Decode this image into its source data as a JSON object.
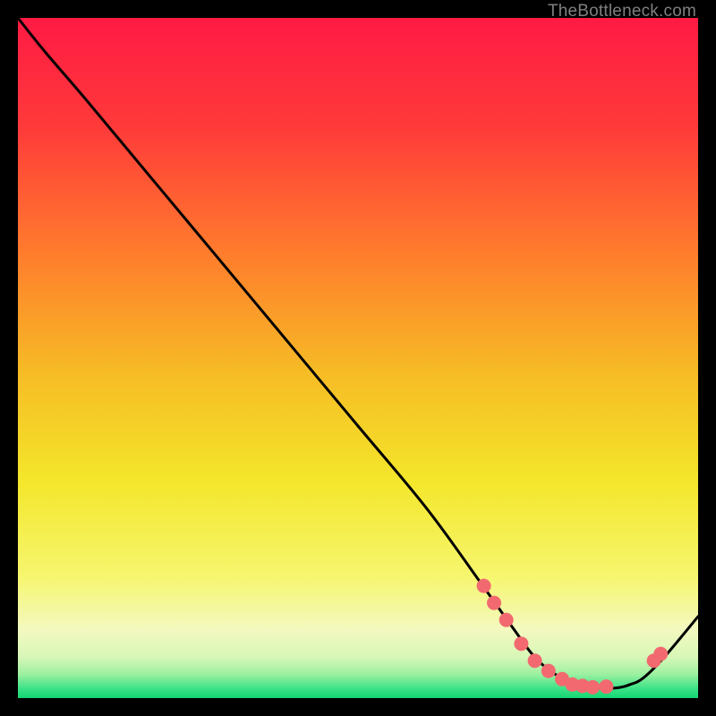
{
  "attribution": "TheBottleneck.com",
  "colors": {
    "frame": "#000000",
    "grad_top": "#ff1a44",
    "grad_mid1": "#ff5a33",
    "grad_mid2": "#f7a223",
    "grad_mid3": "#f6e62a",
    "grad_mid4": "#f9f9a0",
    "grad_bottom": "#17e27a",
    "curve": "#000000",
    "dot_fill": "#f26a6f",
    "dot_stroke": "#b23c40"
  },
  "chart_data": {
    "type": "line",
    "title": "",
    "xlabel": "",
    "ylabel": "",
    "xlim": [
      0,
      1
    ],
    "ylim": [
      0,
      1
    ],
    "series": [
      {
        "name": "bottleneck-curve",
        "x": [
          0.0,
          0.04,
          0.1,
          0.2,
          0.3,
          0.4,
          0.5,
          0.6,
          0.68,
          0.73,
          0.76,
          0.79,
          0.82,
          0.85,
          0.88,
          0.9,
          0.92,
          0.95,
          1.0
        ],
        "y": [
          1.0,
          0.95,
          0.88,
          0.76,
          0.64,
          0.52,
          0.4,
          0.28,
          0.17,
          0.1,
          0.06,
          0.035,
          0.02,
          0.015,
          0.015,
          0.02,
          0.03,
          0.06,
          0.12
        ]
      }
    ],
    "dots": {
      "x": [
        0.685,
        0.7,
        0.718,
        0.74,
        0.76,
        0.78,
        0.8,
        0.815,
        0.83,
        0.845,
        0.865,
        0.935,
        0.945
      ],
      "y": [
        0.165,
        0.14,
        0.115,
        0.08,
        0.055,
        0.04,
        0.028,
        0.02,
        0.018,
        0.016,
        0.017,
        0.055,
        0.065
      ]
    }
  }
}
